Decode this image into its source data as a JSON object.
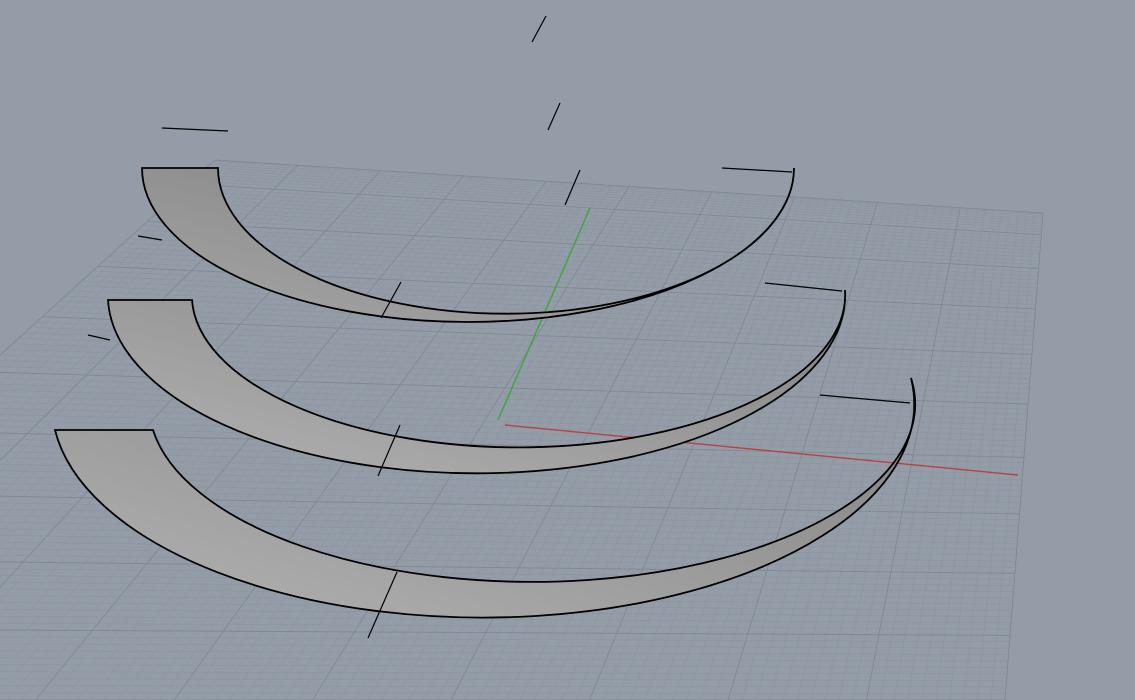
{
  "viewport": {
    "view": "perspective",
    "background_color": "#939ca7",
    "grid_minor_color": "#8a939f",
    "grid_major_color": "#7f8893",
    "x_axis_color": "#b8423f",
    "y_axis_color": "#3fa63c",
    "surface_outline_color": "#000000",
    "surface_color": "#9e9e9e"
  },
  "model": {
    "object": "spiral-ramp-surface",
    "turn_count": 3
  }
}
